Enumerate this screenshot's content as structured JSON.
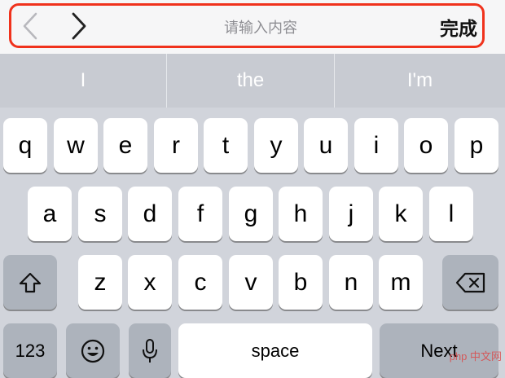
{
  "toolbar": {
    "prev_icon": "chevron-left-icon",
    "next_icon": "chevron-right-icon",
    "placeholder": "请输入内容",
    "done_label": "完成",
    "highlight_color": "#f0321c"
  },
  "suggestions": [
    "I",
    "the",
    "I'm"
  ],
  "keyboard": {
    "row1": [
      "q",
      "w",
      "e",
      "r",
      "t",
      "y",
      "u",
      "i",
      "o",
      "p"
    ],
    "row2": [
      "a",
      "s",
      "d",
      "f",
      "g",
      "h",
      "j",
      "k",
      "l"
    ],
    "row3": [
      "z",
      "x",
      "c",
      "v",
      "b",
      "n",
      "m"
    ],
    "shift_icon": "shift-icon",
    "delete_icon": "delete-backspace-icon",
    "numbers_label": "123",
    "emoji_icon": "emoji-icon",
    "mic_icon": "microphone-icon",
    "space_label": "space",
    "next_label": "Next"
  },
  "watermark": "php 中文网"
}
